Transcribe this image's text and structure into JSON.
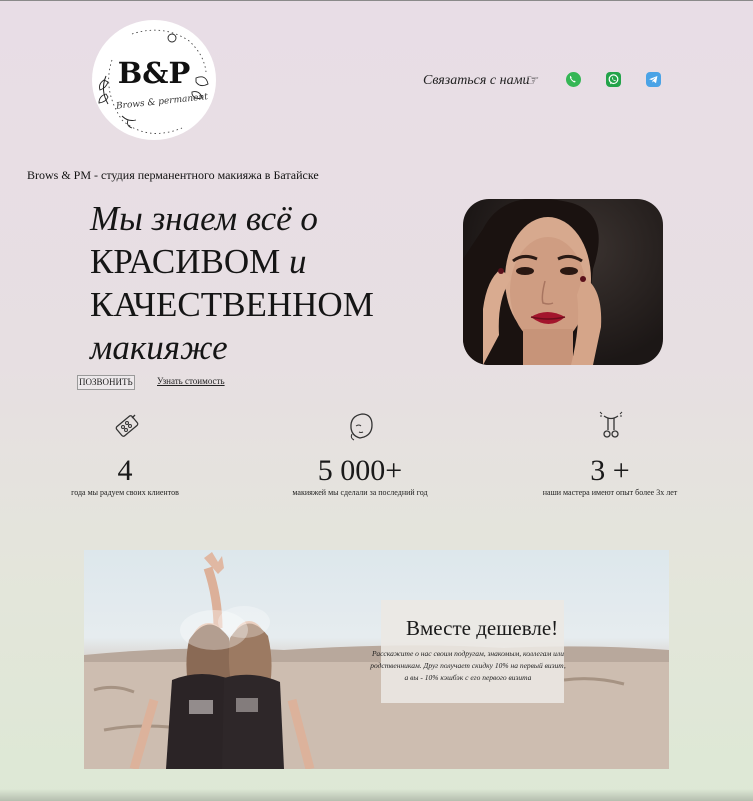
{
  "header": {
    "logo": {
      "mark": "B&P",
      "subtitle": "Brows & permanent"
    },
    "contact_label": "Связаться с нами",
    "hand_icon": "☞",
    "social": [
      {
        "name": "phone-icon",
        "color": "#35b655"
      },
      {
        "name": "whatsapp-icon",
        "color": "#23a34a"
      },
      {
        "name": "telegram-icon",
        "color": "#4aa3e6"
      }
    ]
  },
  "tagline": "Brows & PM - студия перманентного макияжа в Батайске",
  "hero": {
    "line1": "Мы знаем всё о",
    "line2a": "КРАСИВОМ",
    "line2b": "и",
    "line3": "КАЧЕСТВЕННОМ",
    "line4": "макияже",
    "call_button": "ПОЗВОНИТЬ",
    "price_link": "Узнать стоимость"
  },
  "stats": [
    {
      "icon": "palette-icon",
      "value": "4",
      "label": "года мы радуем своих клиентов"
    },
    {
      "icon": "face-icon",
      "value": "5 000+",
      "label": "макияжей мы сделали за последний год"
    },
    {
      "icon": "eyelash-curler-icon",
      "value": "3 +",
      "label": "наши мастера имеют опыт более 3х лет"
    }
  ],
  "promo": {
    "title": "Вместе дешевле!",
    "text": "Расскажите о нас своим подругам, знакомым, коллегам или родственникам. Друг получает скидку 10% на первый визит, а вы - 10% кэшбэк с его первого визита"
  },
  "colors": {
    "whatsapp": "#23a34a",
    "telegram": "#4aa3e6",
    "phone": "#35b655",
    "lips": "#a3152c"
  }
}
